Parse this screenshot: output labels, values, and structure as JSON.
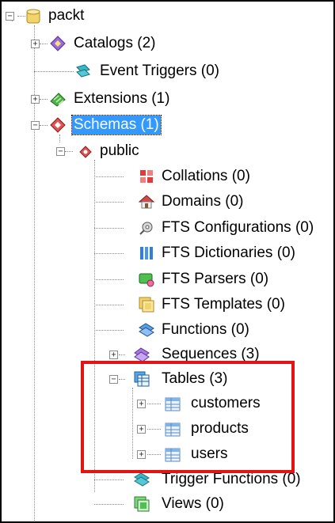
{
  "tree": {
    "root": {
      "label": "packt",
      "icon": "database-icon"
    },
    "catalogs": {
      "label": "Catalogs (2)",
      "icon": "catalog-icon"
    },
    "event_triggers": {
      "label": "Event Triggers (0)",
      "icon": "event-trigger-icon"
    },
    "extensions": {
      "label": "Extensions (1)",
      "icon": "extension-icon"
    },
    "schemas": {
      "label": "Schemas (1)",
      "icon": "schema-icon",
      "selected": true
    },
    "public": {
      "label": "public",
      "icon": "schema-item-icon"
    },
    "collations": {
      "label": "Collations (0)",
      "icon": "collation-icon"
    },
    "domains": {
      "label": "Domains (0)",
      "icon": "domain-icon"
    },
    "fts_configurations": {
      "label": "FTS Configurations (0)",
      "icon": "fts-configuration-icon"
    },
    "fts_dictionaries": {
      "label": "FTS Dictionaries (0)",
      "icon": "fts-dictionary-icon"
    },
    "fts_parsers": {
      "label": "FTS Parsers (0)",
      "icon": "fts-parser-icon"
    },
    "fts_templates": {
      "label": "FTS Templates (0)",
      "icon": "fts-template-icon"
    },
    "functions": {
      "label": "Functions (0)",
      "icon": "function-icon"
    },
    "sequences": {
      "label": "Sequences (3)",
      "icon": "sequence-icon"
    },
    "tables": {
      "label": "Tables (3)",
      "icon": "tables-icon"
    },
    "customers": {
      "label": "customers",
      "icon": "table-icon"
    },
    "products": {
      "label": "products",
      "icon": "table-icon"
    },
    "users": {
      "label": "users",
      "icon": "table-icon"
    },
    "trigger_functions": {
      "label": "Trigger Functions (0)",
      "icon": "trigger-function-icon"
    },
    "views": {
      "label": "Views (0)",
      "icon": "view-icon"
    }
  },
  "expander_glyphs": {
    "collapsed": "+",
    "expanded": "−"
  },
  "colors": {
    "selection": "#3399ff",
    "highlight_box": "#e31414",
    "tree_lines": "#8a8a8a"
  }
}
